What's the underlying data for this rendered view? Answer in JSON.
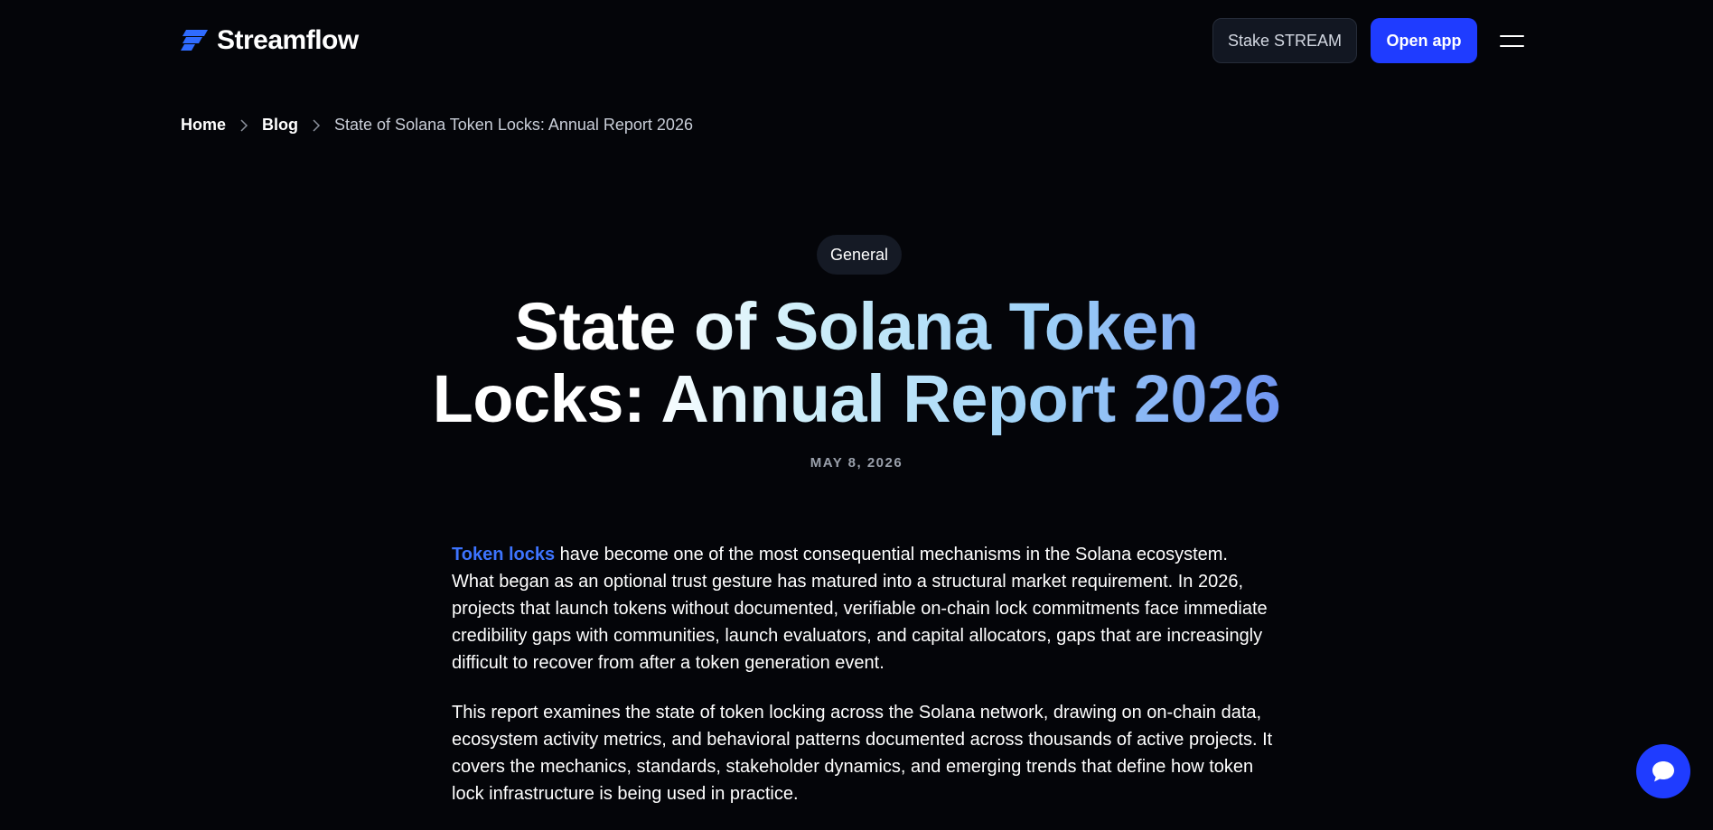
{
  "header": {
    "brand": "Streamflow",
    "stake_label": "Stake STREAM",
    "open_app_label": "Open app"
  },
  "breadcrumb": {
    "home": "Home",
    "blog": "Blog",
    "current": "State of Solana Token Locks: Annual Report 2026"
  },
  "article": {
    "category": "General",
    "title": "State of Solana Token Locks: Annual Report 2026",
    "date": "MAY 8, 2026",
    "paragraph1_link": "Token locks",
    "paragraph1_rest": " have become one of the most consequential mechanisms in the Solana ecosystem. What began as an optional trust gesture has matured into a structural market requirement. In 2026, projects that launch tokens without documented, verifiable on-chain lock commitments face immediate credibility gaps with communities, launch evaluators, and capital allocators, gaps that are increasingly difficult to recover from after a token generation event.",
    "paragraph2": "This report examines the state of token locking across the Solana network, drawing on on-chain data, ecosystem activity metrics, and behavioral patterns documented across thousands of active projects. It covers the mechanics, standards, stakeholder dynamics, and emerging trends that define how token lock infrastructure is being used in practice."
  },
  "icons": {
    "logo": "streamflow-logo-icon",
    "menu": "hamburger-menu-icon",
    "separator": "chevron-right-icon",
    "chat": "chat-bubble-icon"
  },
  "colors": {
    "background": "#040509",
    "accent": "#1f3cff",
    "link": "#3d74ff",
    "title_gradient_end": "#6b8ef0"
  }
}
